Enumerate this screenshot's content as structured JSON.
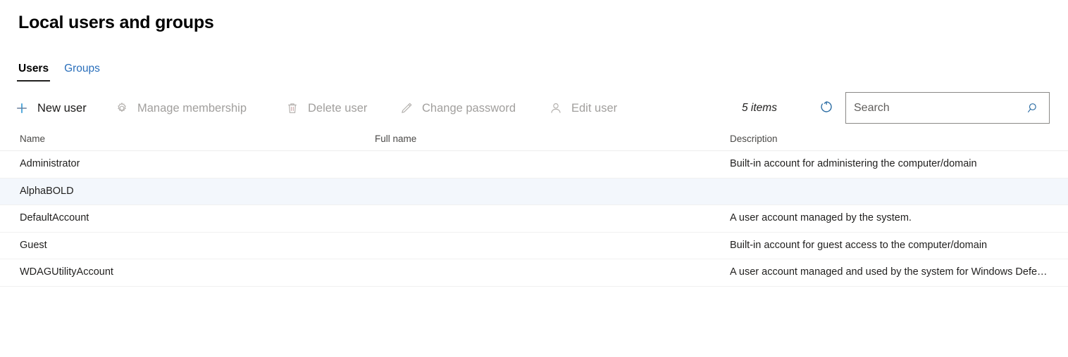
{
  "page": {
    "title": "Local users and groups"
  },
  "tabs": [
    {
      "label": "Users",
      "selected": true
    },
    {
      "label": "Groups",
      "selected": false
    }
  ],
  "colors": {
    "accent": "#0078d4",
    "link": "#2a6fbb",
    "disabled_text": "#a19f9d",
    "row_selected_bg": "#f3f7fc",
    "divider": "#f0f0f0",
    "search_border": "#8a8886"
  },
  "commandbar": {
    "commands": [
      {
        "label": "New user",
        "icon": "plus-icon",
        "enabled": true
      },
      {
        "label": "Manage membership",
        "icon": "gear-icon",
        "enabled": false
      },
      {
        "label": "Delete user",
        "icon": "trash-icon",
        "enabled": false
      },
      {
        "label": "Change password",
        "icon": "pencil-icon",
        "enabled": false
      },
      {
        "label": "Edit user",
        "icon": "person-icon",
        "enabled": false
      }
    ],
    "items_count": "5 items",
    "refresh_icon": "refresh-icon",
    "search": {
      "placeholder": "Search",
      "value": "",
      "icon": "search-icon"
    }
  },
  "table": {
    "columns": [
      {
        "key": "name",
        "label": "Name"
      },
      {
        "key": "full_name",
        "label": "Full name"
      },
      {
        "key": "description",
        "label": "Description"
      }
    ],
    "rows": [
      {
        "name": "Administrator",
        "full_name": "",
        "description": "Built-in account for administering the computer/domain",
        "selected": false
      },
      {
        "name": "AlphaBOLD",
        "full_name": "",
        "description": "",
        "selected": true
      },
      {
        "name": "DefaultAccount",
        "full_name": "",
        "description": "A user account managed by the system.",
        "selected": false
      },
      {
        "name": "Guest",
        "full_name": "",
        "description": "Built-in account for guest access to the computer/domain",
        "selected": false
      },
      {
        "name": "WDAGUtilityAccount",
        "full_name": "",
        "description": "A user account managed and used by the system for Windows Defe…",
        "selected": false
      }
    ]
  }
}
